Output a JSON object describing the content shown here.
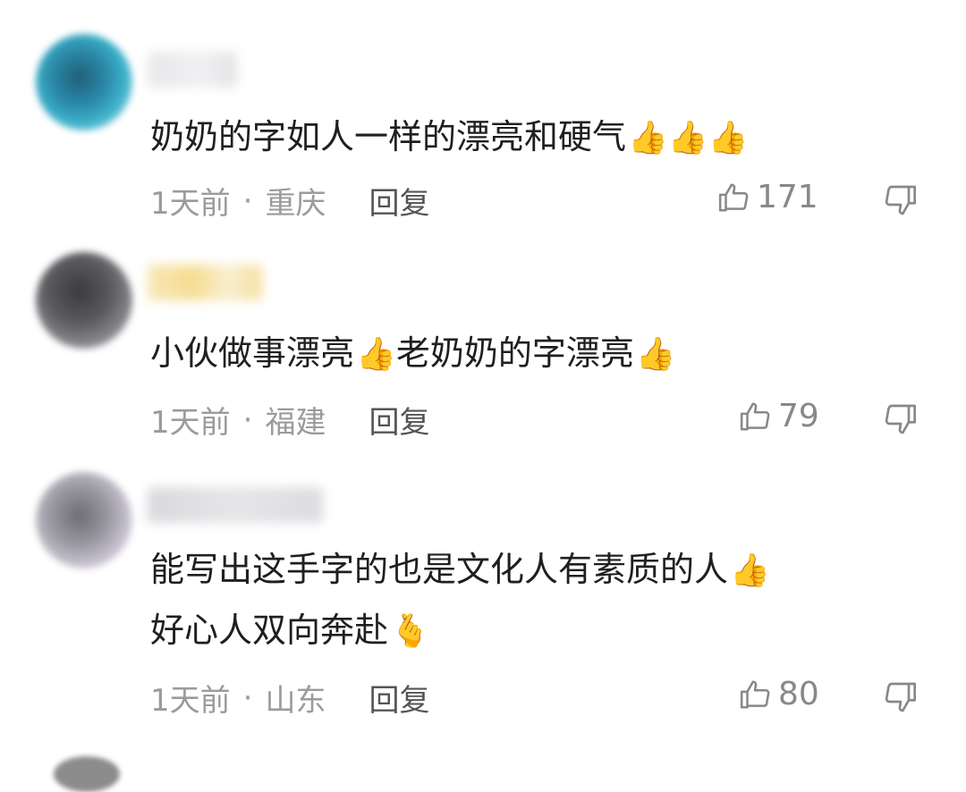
{
  "comments": [
    {
      "text": "奶奶的字如人一样的漂亮和硬气",
      "emoji": "👍👍👍",
      "time": "1天前",
      "location": "重庆",
      "reply_label": "回复",
      "likes": "171"
    },
    {
      "text": "小伙做事漂亮",
      "emoji": "👍",
      "text2": "老奶奶的字漂亮",
      "emoji2": "👍",
      "time": "1天前",
      "location": "福建",
      "reply_label": "回复",
      "likes": "79"
    },
    {
      "text": "能写出这手字的也是文化人有素质的人",
      "emoji": "👍",
      "line2": "好心人双向奔赴",
      "emoji2": "🫰",
      "time": "1天前",
      "location": "山东",
      "reply_label": "回复",
      "likes": "80"
    }
  ],
  "separator": "·",
  "icons": {
    "like": "thumbs-up-outline-icon",
    "dislike": "thumbs-down-outline-icon"
  },
  "colors": {
    "text": "#1f1f1f",
    "meta": "#9b9b9b",
    "reply": "#555555"
  }
}
